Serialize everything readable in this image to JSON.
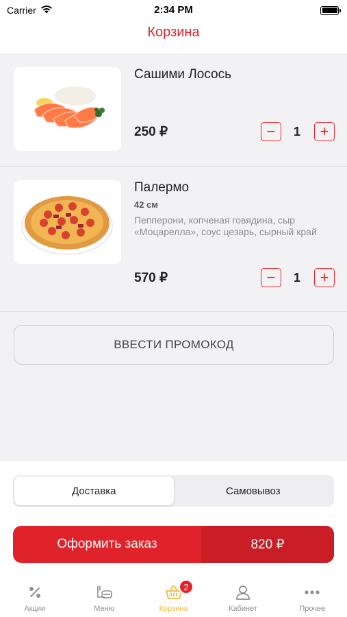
{
  "status_bar": {
    "carrier": "Carrier",
    "time": "2:34 PM"
  },
  "nav": {
    "title": "Корзина"
  },
  "cart": {
    "items": [
      {
        "name": "Сашими Лосось",
        "size": "",
        "description": "",
        "price": "250 ₽",
        "quantity": "1",
        "image": "salmon-sashimi"
      },
      {
        "name": "Палермо",
        "size": "42 см",
        "description": "Пепперони, копченая говядина, сыр «Моцарелла», соус цезарь, сырный край",
        "price": "570 ₽",
        "quantity": "1",
        "image": "pizza"
      }
    ],
    "promo_label": "ВВЕСТИ ПРОМОКОД"
  },
  "delivery": {
    "options": [
      "Доставка",
      "Самовывоз"
    ],
    "selected": "Доставка"
  },
  "order": {
    "label": "Оформить заказ",
    "total": "820 ₽"
  },
  "tabs": [
    {
      "label": "Акции",
      "icon": "percent-icon"
    },
    {
      "label": "Меню",
      "icon": "menu-icon"
    },
    {
      "label": "Корзина",
      "icon": "basket-icon",
      "badge": "2",
      "active": true
    },
    {
      "label": "Кабинет",
      "icon": "person-icon"
    },
    {
      "label": "Прочее",
      "icon": "more-icon"
    }
  ],
  "colors": {
    "accent": "#e0232b",
    "active_tab": "#f0b840",
    "background": "#f2f2f4"
  }
}
